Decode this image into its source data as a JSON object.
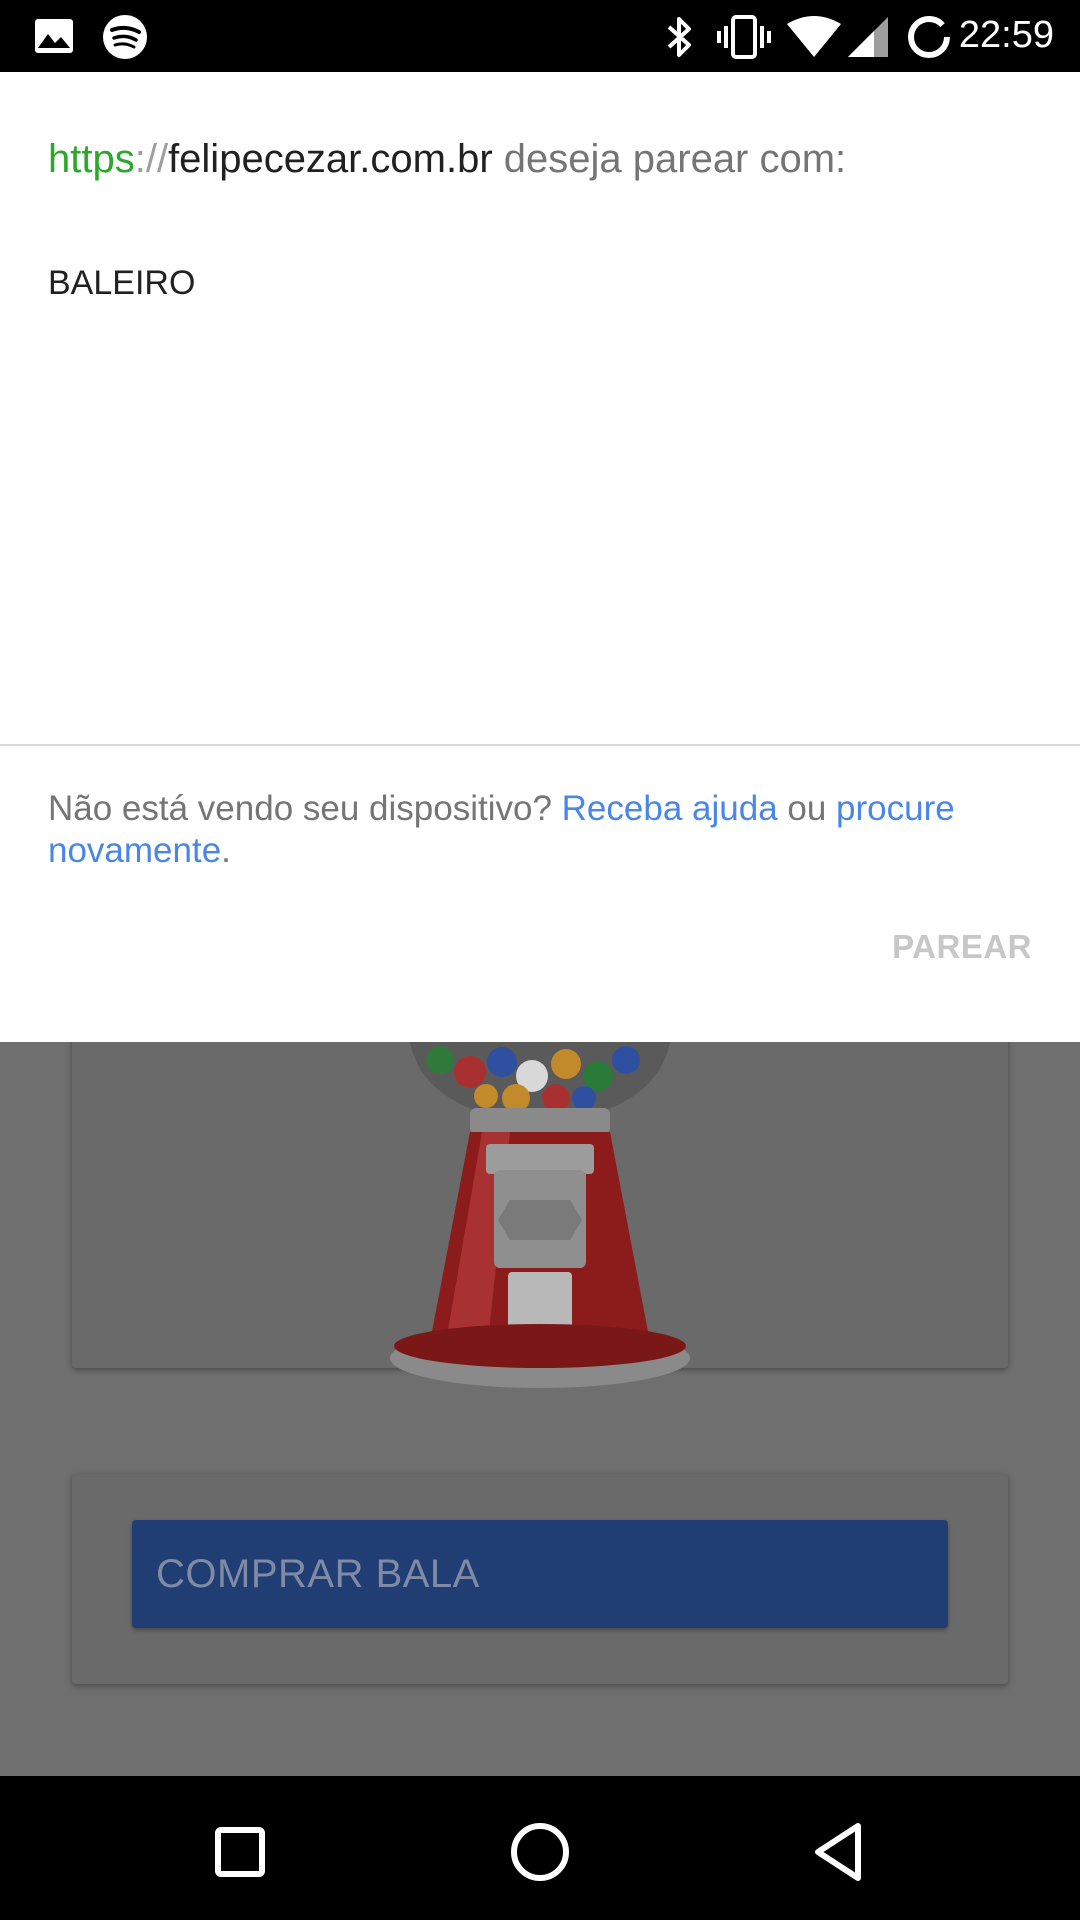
{
  "status_bar": {
    "time": "22:59",
    "icons": [
      "image-icon",
      "spotify-icon",
      "bluetooth-icon",
      "vibrate-icon",
      "wifi-icon",
      "cell-signal-icon",
      "battery-saver-icon"
    ]
  },
  "dialog": {
    "origin": {
      "scheme": "https",
      "separator": "://",
      "host": "felipecezar.com.br",
      "message": " deseja parear com:"
    },
    "devices": [
      "BALEIRO"
    ],
    "help": {
      "prefix": "Não está vendo seu dispositivo? ",
      "get_help_link": "Receba ajuda",
      "middle": " ou ",
      "search_again_link": "procure novamente",
      "suffix": "."
    },
    "pair_button": "PAREAR"
  },
  "background_page": {
    "buy_button": "COMPRAR BALA"
  },
  "colors": {
    "scheme_green": "#2ba72b",
    "link_blue": "#4a86e8",
    "buy_button_bg": "#213e74",
    "scrim": "#6f6f6f"
  },
  "nav_bar": {
    "buttons": [
      "recents-icon",
      "home-icon",
      "back-icon"
    ]
  }
}
